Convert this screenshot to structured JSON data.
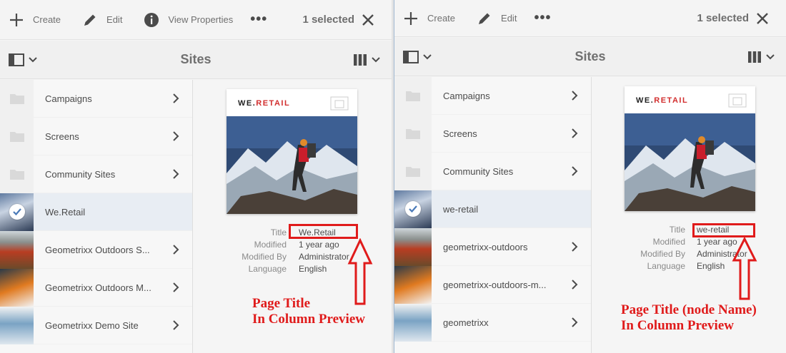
{
  "left": {
    "actions": {
      "create": "Create",
      "edit": "Edit",
      "view_properties": "View Properties",
      "more": "•••"
    },
    "selection": "1 selected",
    "header": {
      "title": "Sites"
    },
    "items": [
      {
        "label": "Campaigns"
      },
      {
        "label": "Screens"
      },
      {
        "label": "Community Sites"
      },
      {
        "label": "We.Retail"
      },
      {
        "label": "Geometrixx Outdoors S..."
      },
      {
        "label": "Geometrixx Outdoors M..."
      },
      {
        "label": "Geometrixx Demo Site"
      }
    ],
    "preview": {
      "brand_prefix": "WE.",
      "brand_accent": "RETAIL",
      "props": [
        {
          "key": "Title",
          "value": "We.Retail"
        },
        {
          "key": "Modified",
          "value": "1 year ago"
        },
        {
          "key": "Modified By",
          "value": "Administrator"
        },
        {
          "key": "Language",
          "value": "English"
        }
      ]
    },
    "annotation": {
      "line1": "Page Title",
      "line2": "In Column Preview"
    }
  },
  "right": {
    "actions": {
      "create": "Create",
      "edit": "Edit",
      "more": "•••"
    },
    "selection": "1 selected",
    "header": {
      "title": "Sites"
    },
    "items": [
      {
        "label": "Campaigns"
      },
      {
        "label": "Screens"
      },
      {
        "label": "Community Sites"
      },
      {
        "label": "we-retail"
      },
      {
        "label": "geometrixx-outdoors"
      },
      {
        "label": "geometrixx-outdoors-m..."
      },
      {
        "label": "geometrixx"
      }
    ],
    "preview": {
      "brand_prefix": "WE.",
      "brand_accent": "RETAIL",
      "props": [
        {
          "key": "Title",
          "value": "we-retail"
        },
        {
          "key": "Modified",
          "value": "1 year ago"
        },
        {
          "key": "Modified By",
          "value": "Administrator"
        },
        {
          "key": "Language",
          "value": "English"
        }
      ]
    },
    "annotation": {
      "line1": "Page Title (node Name)",
      "line2": "In Column Preview"
    }
  },
  "colors": {
    "annotation": "#e01b1b",
    "brand_accent": "#d22e2e",
    "selected_row": "#e8edf3"
  }
}
